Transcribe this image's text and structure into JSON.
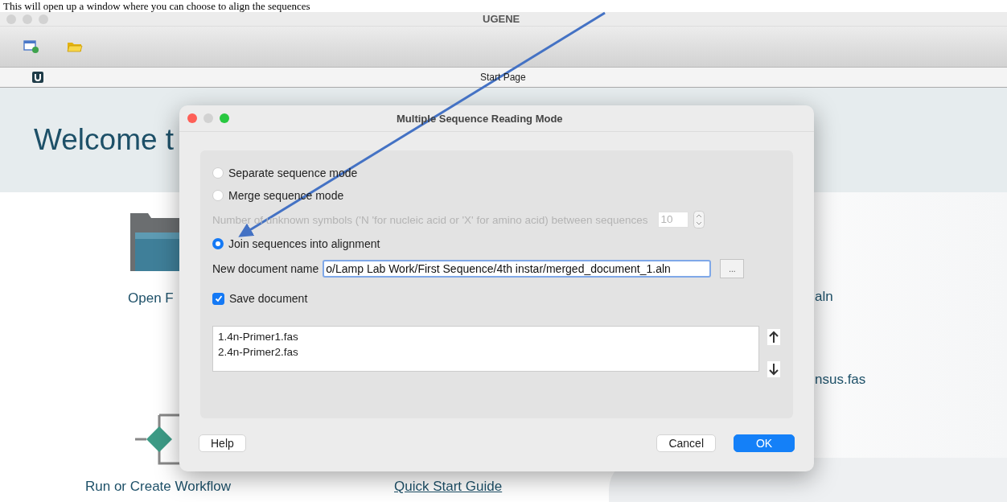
{
  "caption": "This will open up a window where you can choose to align the sequences",
  "app": {
    "title": "UGENE"
  },
  "tab": {
    "label": "Start Page"
  },
  "start_page": {
    "welcome": "Welcome t",
    "open_files": "Open F",
    "recent_files": [
      "aln",
      "nsus.fas"
    ],
    "run_workflow": "Run or Create Workflow",
    "quick_start_guide": "Quick Start Guide"
  },
  "dialog": {
    "title": "Multiple Sequence Reading Mode",
    "modes": [
      {
        "label": "Separate sequence mode",
        "selected": false
      },
      {
        "label": "Merge sequence mode",
        "selected": false
      },
      {
        "label": "Join sequences into alignment",
        "selected": true
      }
    ],
    "unknown_symbols": {
      "label": "Number of unknown symbols ('N 'for nucleic acid or 'X' for amino acid) between sequences",
      "value": "10",
      "disabled": true
    },
    "document_name": {
      "label": "New document name",
      "value": "o/Lamp Lab Work/First Sequence/4th instar/merged_document_1.aln"
    },
    "browse_button": "...",
    "save_document": {
      "label": "Save document",
      "checked": true
    },
    "files": [
      "1.4n-Primer1.fas",
      "2.4n-Primer2.fas"
    ],
    "buttons": {
      "help": "Help",
      "cancel": "Cancel",
      "ok": "OK"
    }
  }
}
